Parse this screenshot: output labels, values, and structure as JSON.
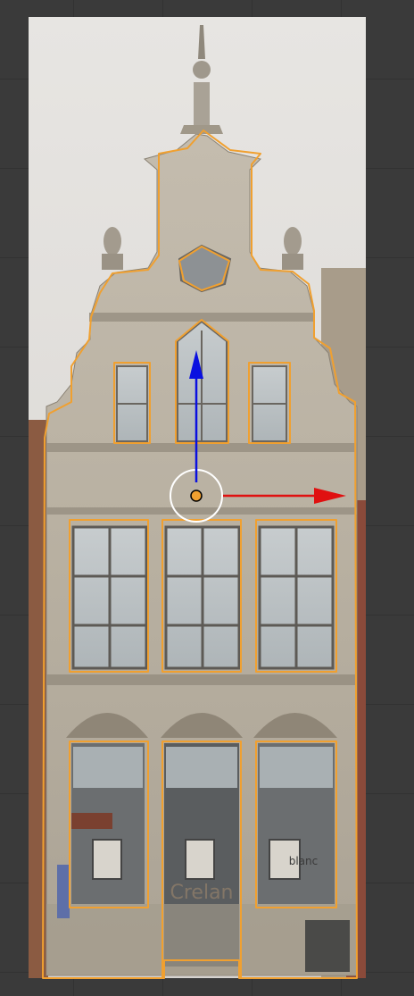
{
  "viewport": {
    "type": "3d-editor-viewport",
    "mode": "object-edit",
    "selection_color": "#f0a030"
  },
  "image_plane": {
    "subject": "building-facade-photo",
    "storefront_text": "Crelan",
    "side_sign_text": "blanc"
  },
  "gizmo": {
    "y_axis_color": "#0a10e0",
    "x_axis_color": "#e01010",
    "origin_color": "#f0a030",
    "center_ring_color": "#ffffff"
  },
  "outline_shapes": [
    "facade-outline",
    "top-gable-window",
    "arched-window",
    "left-upper-window",
    "right-upper-window",
    "middle-left-window",
    "middle-center-window",
    "middle-right-window",
    "ground-left-window",
    "door-opening",
    "ground-right-window"
  ]
}
